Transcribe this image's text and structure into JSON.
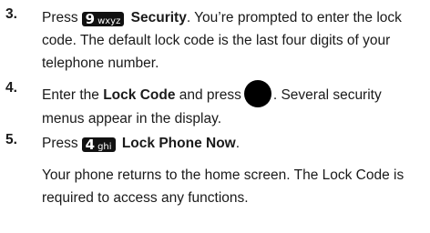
{
  "steps": [
    {
      "number": "3.",
      "prefix": "Press",
      "key": {
        "digit": "9",
        "letters": "wxyz"
      },
      "bold": "Security",
      "text": ". You’re prompted to enter the lock code. The default lock code is the last four digits of your telephone number."
    },
    {
      "number": "4.",
      "prefix": "Enter the",
      "bold": "Lock Code",
      "middle": "and press",
      "key_icon": "ok-key-icon",
      "text": ". Several security menus appear in the display."
    },
    {
      "number": "5.",
      "prefix": "Press",
      "key": {
        "digit": "4",
        "letters": "ghi"
      },
      "bold": "Lock Phone Now",
      "text": "."
    }
  ],
  "note": "Your phone returns to the home screen. The Lock Code is required to access any functions."
}
